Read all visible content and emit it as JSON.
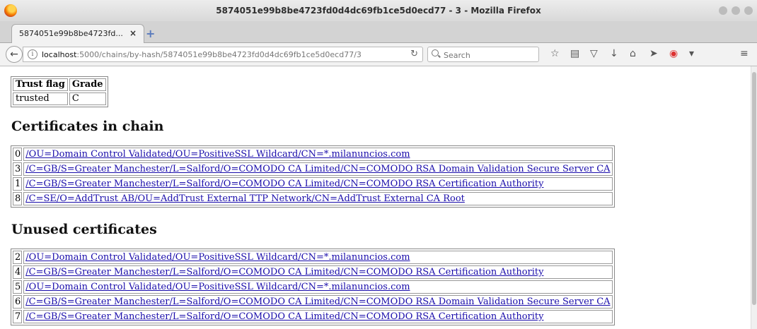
{
  "window": {
    "title": "5874051e99b8be4723fd0d4dc69fb1ce5d0ecd77 - 3 - Mozilla Firefox"
  },
  "tab": {
    "label": "5874051e99b8be4723fd...",
    "close": "×",
    "new_tab": "+"
  },
  "nav": {
    "url_host": "localhost",
    "url_rest": ":5000/chains/by-hash/5874051e99b8be4723fd0d4dc69fb1ce5d0ecd77/3",
    "search_placeholder": "Search"
  },
  "trust_table": {
    "headers": [
      "Trust flag",
      "Grade"
    ],
    "row": [
      "trusted",
      "C"
    ]
  },
  "chain_section": {
    "title": "Certificates in chain",
    "rows": [
      {
        "index": "0",
        "subject": "/OU=Domain Control Validated/OU=PositiveSSL Wildcard/CN=*.milanuncios.com"
      },
      {
        "index": "3",
        "subject": "/C=GB/S=Greater Manchester/L=Salford/O=COMODO CA Limited/CN=COMODO RSA Domain Validation Secure Server CA"
      },
      {
        "index": "1",
        "subject": "/C=GB/S=Greater Manchester/L=Salford/O=COMODO CA Limited/CN=COMODO RSA Certification Authority"
      },
      {
        "index": "8",
        "subject": "/C=SE/O=AddTrust AB/OU=AddTrust External TTP Network/CN=AddTrust External CA Root"
      }
    ]
  },
  "unused_section": {
    "title": "Unused certificates",
    "rows": [
      {
        "index": "2",
        "subject": "/OU=Domain Control Validated/OU=PositiveSSL Wildcard/CN=*.milanuncios.com"
      },
      {
        "index": "4",
        "subject": "/C=GB/S=Greater Manchester/L=Salford/O=COMODO CA Limited/CN=COMODO RSA Certification Authority"
      },
      {
        "index": "5",
        "subject": "/OU=Domain Control Validated/OU=PositiveSSL Wildcard/CN=*.milanuncios.com"
      },
      {
        "index": "6",
        "subject": "/C=GB/S=Greater Manchester/L=Salford/O=COMODO CA Limited/CN=COMODO RSA Domain Validation Secure Server CA"
      },
      {
        "index": "7",
        "subject": "/C=GB/S=Greater Manchester/L=Salford/O=COMODO CA Limited/CN=COMODO RSA Certification Authority"
      }
    ]
  }
}
